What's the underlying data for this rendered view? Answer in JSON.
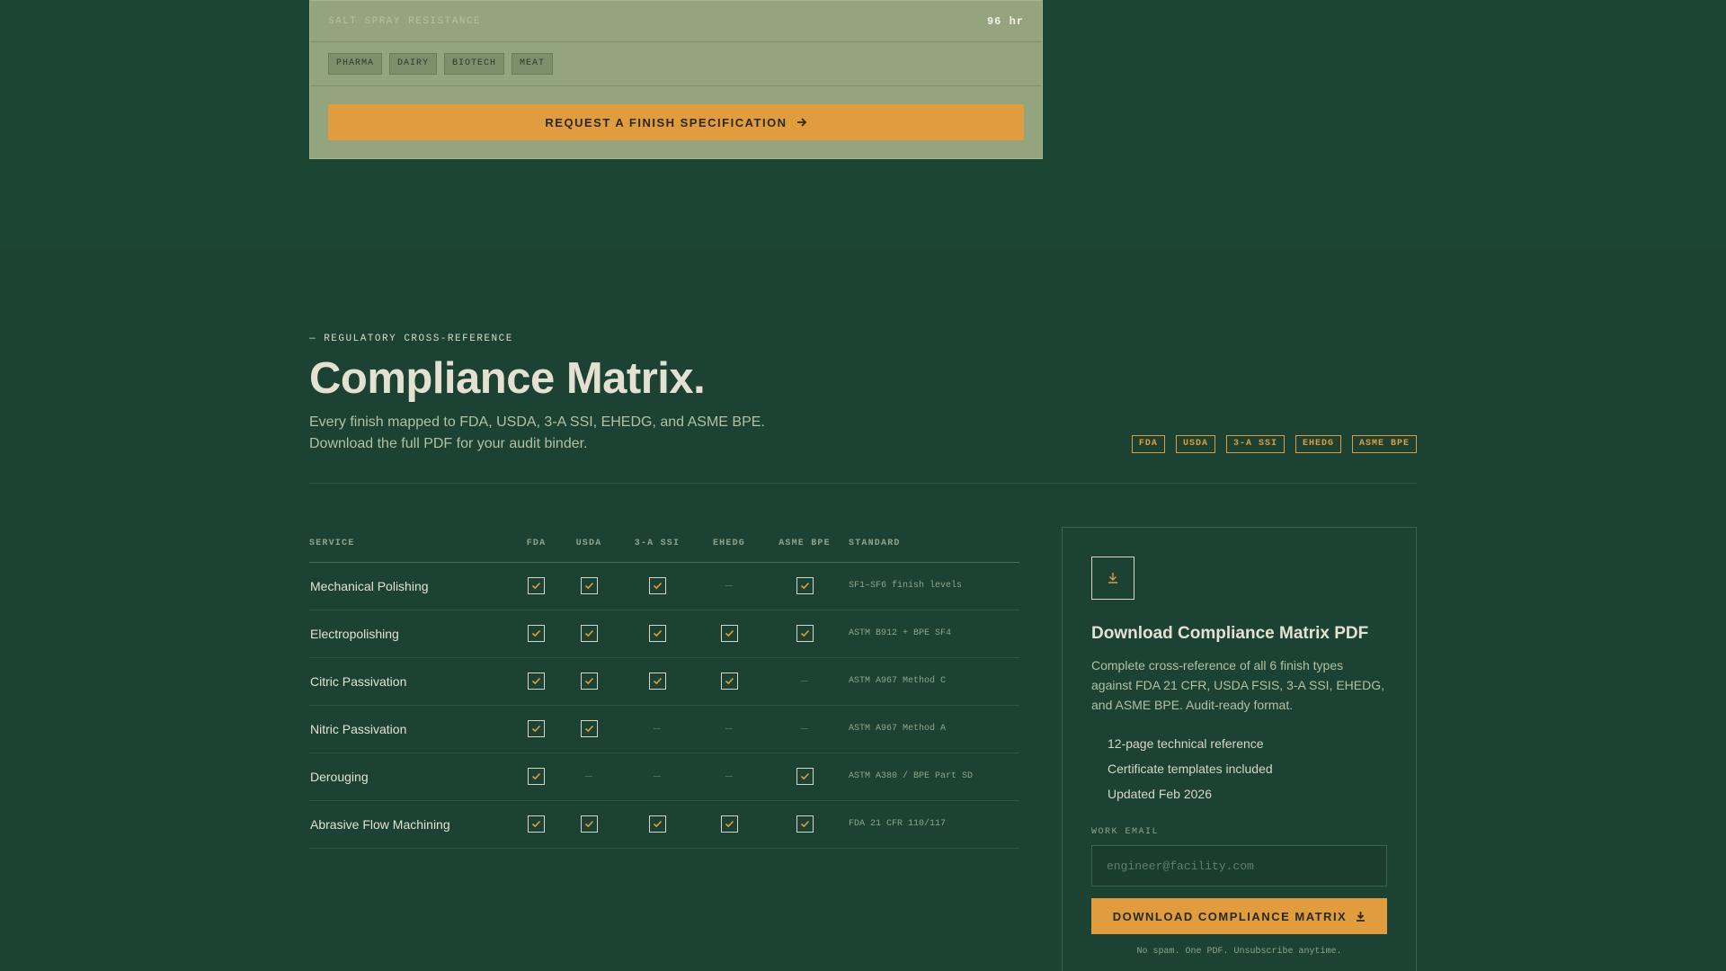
{
  "finish_card": {
    "spec_label": "SALT SPRAY RESISTANCE",
    "spec_value": "96 hr",
    "industries": [
      "PHARMA",
      "DAIRY",
      "BIOTECH",
      "MEAT"
    ],
    "cta_label": "REQUEST A FINISH SPECIFICATION",
    "cta_icon": "arrow-right-icon"
  },
  "section": {
    "eyebrow": "— REGULATORY CROSS-REFERENCE",
    "title": "Compliance Matrix.",
    "subtitle": "Every finish mapped to FDA, USDA, 3-A SSI, EHEDG, and ASME BPE. Download the full PDF for your audit binder.",
    "badges": [
      "FDA",
      "USDA",
      "3-A SSI",
      "EHEDG",
      "ASME BPE"
    ]
  },
  "matrix": {
    "headers": [
      "SERVICE",
      "FDA",
      "USDA",
      "3-A SSI",
      "EHEDG",
      "ASME BPE",
      "STANDARD"
    ],
    "rows": [
      {
        "service": "Mechanical Polishing",
        "marks": [
          true,
          true,
          true,
          false,
          true
        ],
        "standard": "SF1–SF6 finish levels"
      },
      {
        "service": "Electropolishing",
        "marks": [
          true,
          true,
          true,
          true,
          true
        ],
        "standard": "ASTM B912 + BPE SF4"
      },
      {
        "service": "Citric Passivation",
        "marks": [
          true,
          true,
          true,
          true,
          false
        ],
        "standard": "ASTM A967 Method C"
      },
      {
        "service": "Nitric Passivation",
        "marks": [
          true,
          true,
          false,
          false,
          false
        ],
        "standard": "ASTM A967 Method A"
      },
      {
        "service": "Derouging",
        "marks": [
          true,
          false,
          false,
          false,
          true
        ],
        "standard": "ASTM A380 / BPE Part SD"
      },
      {
        "service": "Abrasive Flow Machining",
        "marks": [
          true,
          true,
          true,
          true,
          true
        ],
        "standard": "FDA 21 CFR 110/117"
      }
    ]
  },
  "download": {
    "icon": "download-icon",
    "title": "Download Compliance Matrix PDF",
    "description": "Complete cross-reference of all 6 finish types against FDA 21 CFR, USDA FSIS, 3-A SSI, EHEDG, and ASME BPE. Audit-ready format.",
    "features": [
      "12-page technical reference",
      "Certificate templates included",
      "Updated Feb 2026"
    ],
    "email_label": "WORK EMAIL",
    "email_placeholder": "engineer@facility.com",
    "button_label": "DOWNLOAD COMPLIANCE MATRIX",
    "fine_print": "No spam. One PDF. Unsubscribe anytime."
  },
  "colors": {
    "background": "#1b4232",
    "accent": "#e19c3d",
    "card": "#93a47e"
  }
}
